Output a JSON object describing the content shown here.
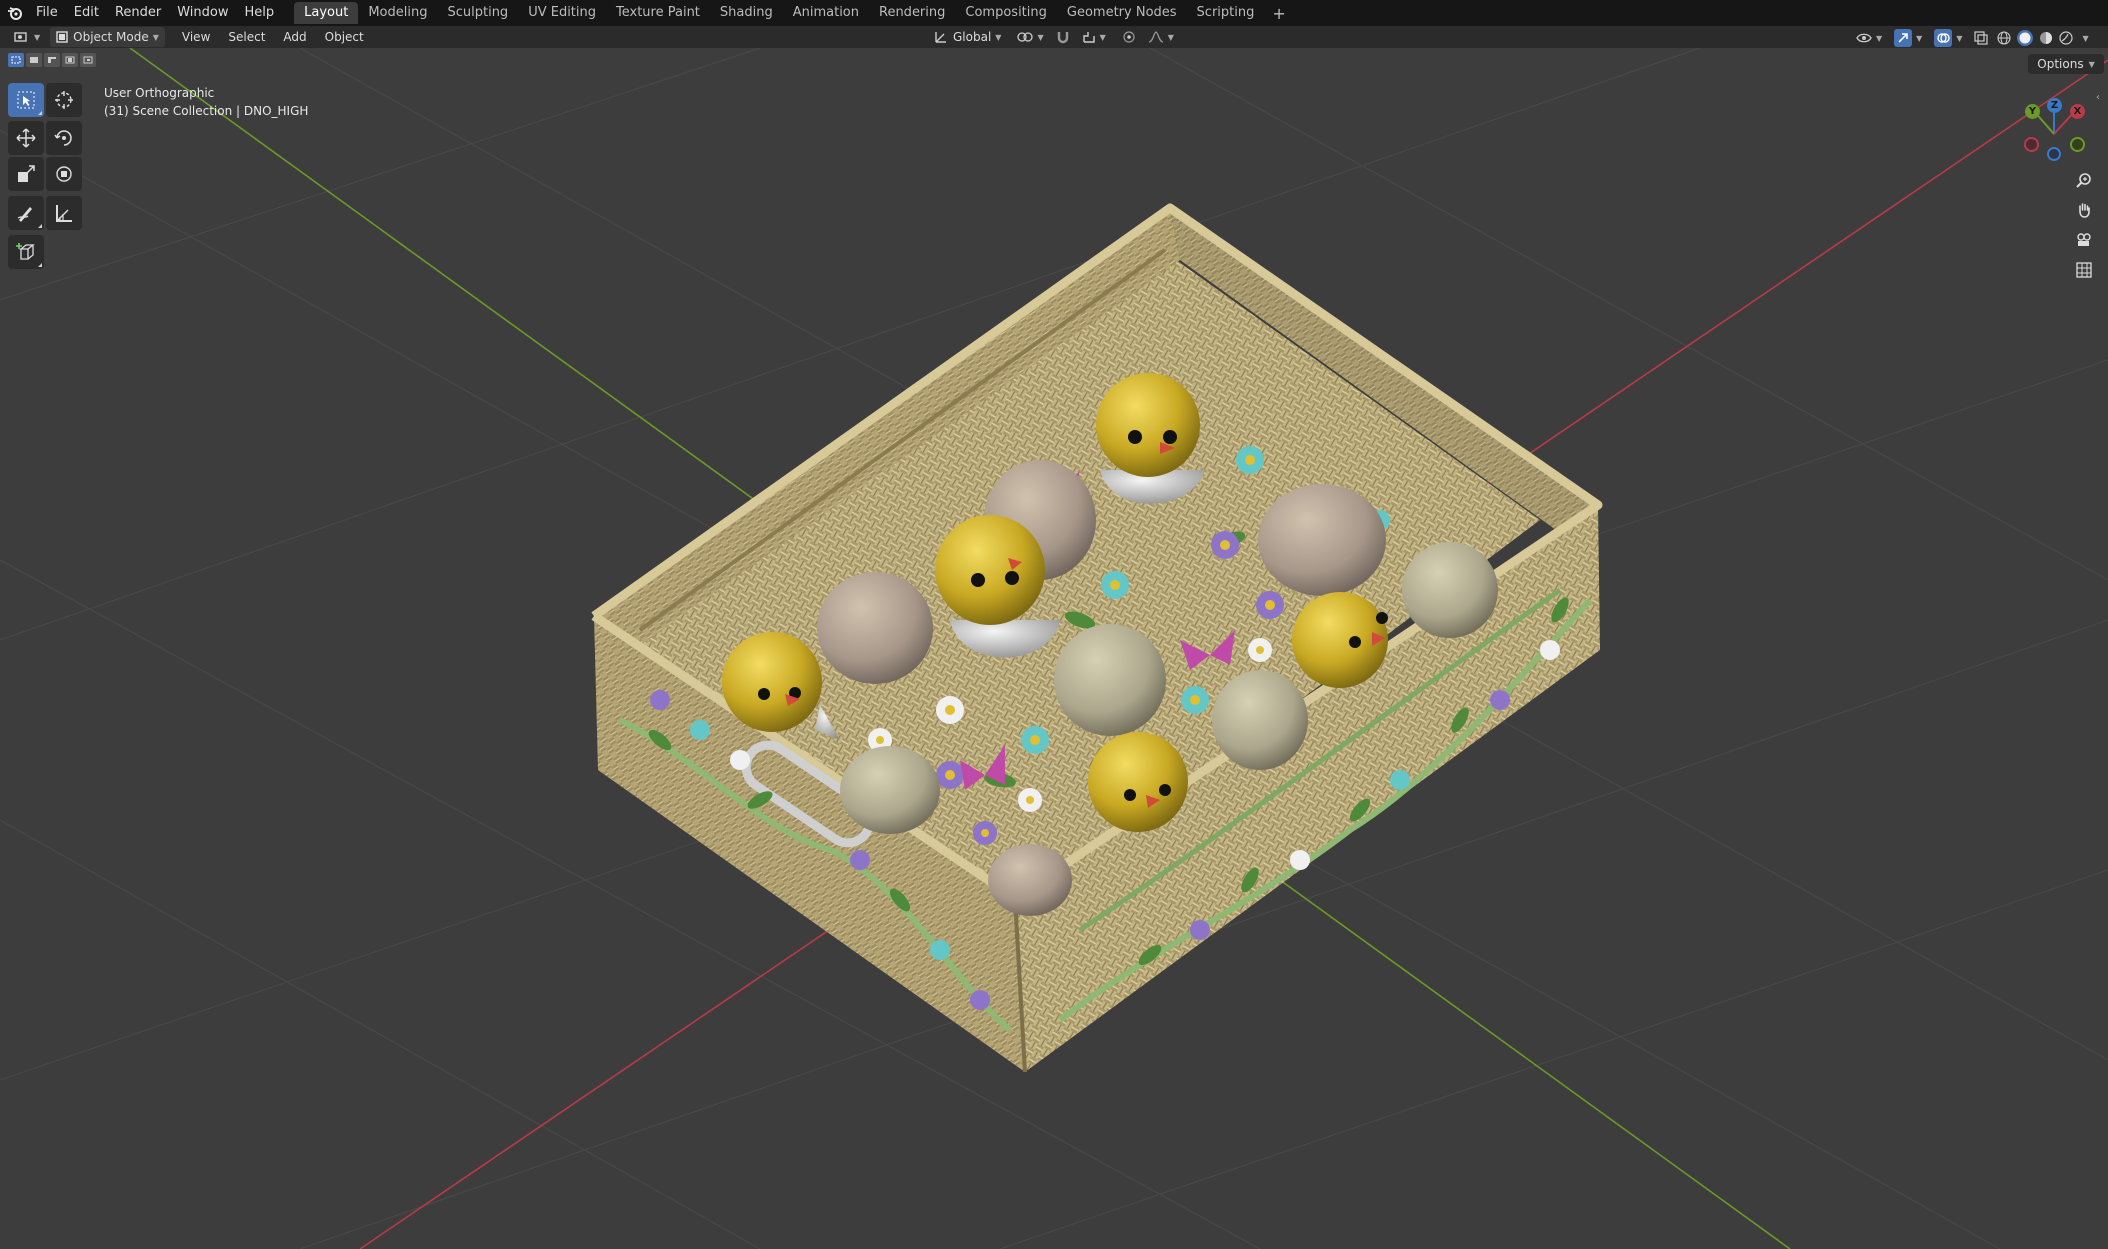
{
  "menu": [
    "File",
    "Edit",
    "Render",
    "Window",
    "Help"
  ],
  "workspaces": [
    "Layout",
    "Modeling",
    "Sculpting",
    "UV Editing",
    "Texture Paint",
    "Shading",
    "Animation",
    "Rendering",
    "Compositing",
    "Geometry Nodes",
    "Scripting"
  ],
  "active_workspace": "Layout",
  "header": {
    "mode": "Object Mode",
    "menus": [
      "View",
      "Select",
      "Add",
      "Object"
    ],
    "transform_orientation": "Global"
  },
  "viewport": {
    "view_name": "User Orthographic",
    "collection_info": "(31) Scene Collection | DNO_HIGH",
    "options_label": "Options"
  },
  "gizmo": {
    "x": "X",
    "y": "Y",
    "z": "Z"
  },
  "colors": {
    "x_axis": "#b93a48",
    "y_axis": "#6b9a28",
    "z_axis": "#3a78c8",
    "accent": "#4772b3",
    "basket": "#c9b98a",
    "chick": "#d4b62a",
    "egg": "#a89a86",
    "background": "#3d3d3d"
  },
  "icons": {
    "tools": [
      "select-box-icon",
      "cursor-icon",
      "move-icon",
      "rotate-icon",
      "scale-icon",
      "transform-icon",
      "annotate-icon",
      "measure-icon",
      "add-cube-icon"
    ],
    "nav": [
      "zoom-icon",
      "pan-hand-icon",
      "camera-icon",
      "ortho-grid-icon"
    ]
  }
}
